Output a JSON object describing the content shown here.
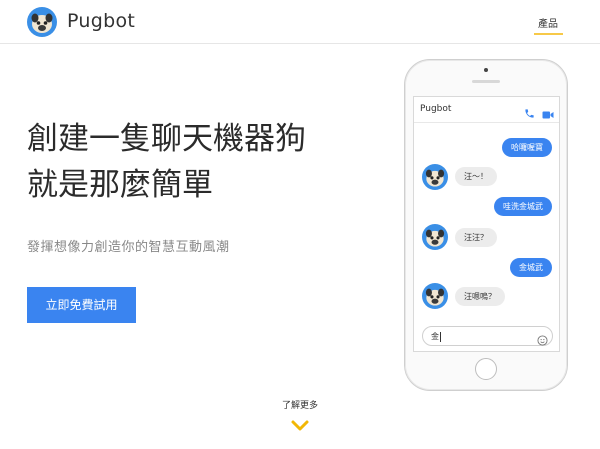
{
  "header": {
    "brand": "Pugbot",
    "nav": [
      "產品"
    ]
  },
  "hero": {
    "title_line1": "創建一隻聊天機器狗",
    "title_line2": "就是那麼簡單",
    "subtitle": "發揮想像力創造你的智慧互動風潮",
    "cta_label": "立即免費試用"
  },
  "phone": {
    "chat_title": "Pugbot",
    "messages": [
      {
        "from": "user",
        "text": "哈囉喔寶"
      },
      {
        "from": "bot",
        "text": "汪～！"
      },
      {
        "from": "user",
        "text": "哇洗金城武"
      },
      {
        "from": "bot",
        "text": "汪汪？"
      },
      {
        "from": "user",
        "text": "金城武"
      },
      {
        "from": "bot",
        "text": "汪嗯嗚？"
      }
    ],
    "input_value": "金"
  },
  "learn_more": "了解更多",
  "colors": {
    "accent": "#3a84f0",
    "underline": "#f7c948",
    "chevron": "#f2b705"
  }
}
